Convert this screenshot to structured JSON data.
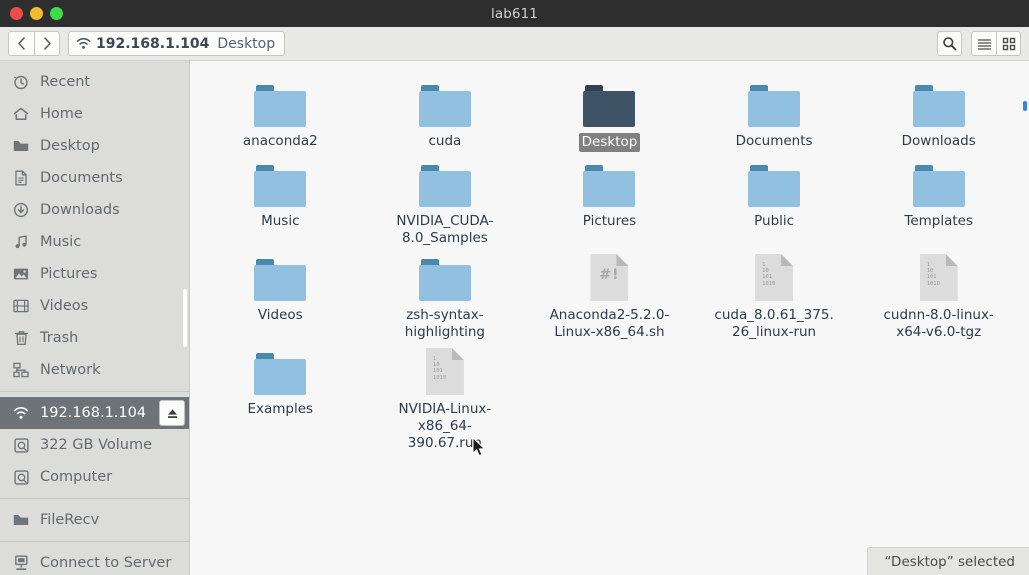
{
  "window": {
    "title": "lab611",
    "controls": [
      {
        "name": "close",
        "color": "#ee4b4b"
      },
      {
        "name": "minimize",
        "color": "#f2bc2e"
      },
      {
        "name": "maximize",
        "color": "#3ddc48"
      }
    ]
  },
  "toolbar": {
    "back_label": "‹",
    "forward_label": "›",
    "path_segments": [
      {
        "label": "192.168.1.104",
        "icon": "wifi-icon",
        "current": true
      },
      {
        "label": "Desktop",
        "icon": "",
        "current": false
      }
    ],
    "search_label": "Search",
    "list_view_label": "List view",
    "grid_view_label": "Grid view"
  },
  "sidebar": {
    "groups": [
      {
        "items": [
          {
            "label": "Recent",
            "icon": "clock-icon",
            "selected": false
          },
          {
            "label": "Home",
            "icon": "home-icon",
            "selected": false
          },
          {
            "label": "Desktop",
            "icon": "folder-icon",
            "selected": false
          },
          {
            "label": "Documents",
            "icon": "document-icon",
            "selected": false
          },
          {
            "label": "Downloads",
            "icon": "download-icon",
            "selected": false
          },
          {
            "label": "Music",
            "icon": "music-icon",
            "selected": false
          },
          {
            "label": "Pictures",
            "icon": "picture-icon",
            "selected": false
          },
          {
            "label": "Videos",
            "icon": "video-icon",
            "selected": false
          },
          {
            "label": "Trash",
            "icon": "trash-icon",
            "selected": false
          },
          {
            "label": "Network",
            "icon": "network-icon",
            "selected": false
          }
        ]
      },
      {
        "items": [
          {
            "label": "192.168.1.104",
            "icon": "wifi-icon",
            "selected": true,
            "eject": true
          },
          {
            "label": "322 GB Volume",
            "icon": "drive-icon",
            "selected": false
          },
          {
            "label": "Computer",
            "icon": "drive-icon",
            "selected": false
          }
        ]
      },
      {
        "items": [
          {
            "label": "FileRecv",
            "icon": "folder-icon",
            "selected": false
          }
        ]
      },
      {
        "items": [
          {
            "label": "Connect to Server",
            "icon": "server-icon",
            "selected": false
          }
        ]
      }
    ]
  },
  "files": [
    {
      "name": "anaconda2",
      "type": "folder",
      "selected": false
    },
    {
      "name": "cuda",
      "type": "folder",
      "selected": false
    },
    {
      "name": "Desktop",
      "type": "folder",
      "selected": true
    },
    {
      "name": "Documents",
      "type": "folder",
      "selected": false
    },
    {
      "name": "Downloads",
      "type": "folder",
      "selected": false
    },
    {
      "name": "Music",
      "type": "folder",
      "selected": false
    },
    {
      "name": "NVIDIA_CUDA-8.0_Samples",
      "type": "folder",
      "selected": false
    },
    {
      "name": "Pictures",
      "type": "folder",
      "selected": false
    },
    {
      "name": "Public",
      "type": "folder",
      "selected": false
    },
    {
      "name": "Templates",
      "type": "folder",
      "selected": false
    },
    {
      "name": "Videos",
      "type": "folder",
      "selected": false
    },
    {
      "name": "zsh-syntax-highlighting",
      "type": "folder",
      "selected": false
    },
    {
      "name": "Anaconda2-5.2.0-Linux-x86_64.sh",
      "type": "script",
      "selected": false,
      "glyph": "#!"
    },
    {
      "name": "cuda_8.0.61_375.26_linux-run",
      "type": "binary",
      "selected": false
    },
    {
      "name": "cudnn-8.0-linux-x64-v6.0-tgz",
      "type": "binary",
      "selected": false
    },
    {
      "name": "Examples",
      "type": "folder",
      "selected": false
    },
    {
      "name": "NVIDIA-Linux-x86_64-390.67.run",
      "type": "binary",
      "selected": false
    }
  ],
  "binary_glyph_lines": [
    "1",
    "10",
    "101",
    "1010"
  ],
  "status": {
    "text": "“Desktop”  selected"
  },
  "colors": {
    "titlebar_bg": "#2e2e2e",
    "toolbar_bg": "#e8e8e6",
    "sidebar_bg": "#dcdcda",
    "content_bg": "#f7f7f7",
    "folder_body": "#92c0e0",
    "folder_tab": "#4a89ab",
    "folder_body_selected": "#3f5366",
    "selection_label_bg": "#808080",
    "sidebar_selected_bg": "#6e7377",
    "accent": "#3584e4"
  }
}
